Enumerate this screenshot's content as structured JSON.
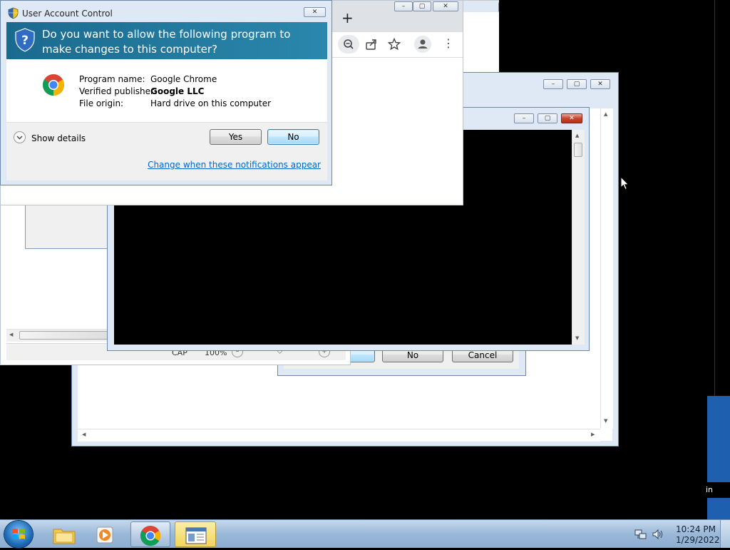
{
  "uac": {
    "title": "User Account Control",
    "question": "Do you want to allow the following program to make changes to this computer?",
    "labels": {
      "program": "Program name:",
      "publisher": "Verified publisher:",
      "origin": "File origin:"
    },
    "values": {
      "program": "Google Chrome",
      "publisher": "Google LLC",
      "origin": "Hard drive on this computer"
    },
    "show_details": "Show details",
    "yes": "Yes",
    "no": "No",
    "change_link": "Change when these notifications appear"
  },
  "chrome": {
    "new_tab": "+"
  },
  "background_dialog": {
    "no": "No",
    "cancel": "Cancel"
  },
  "status_bar": {
    "cap": "CAP",
    "zoom": "100%"
  },
  "desktop": {
    "edge_text": "in"
  },
  "tray": {
    "time": "10:24 PM",
    "date": "1/29/2022"
  },
  "colors": {
    "uac_banner": "#1a6a8e",
    "link": "#0066cc",
    "desktop": "#000000"
  }
}
